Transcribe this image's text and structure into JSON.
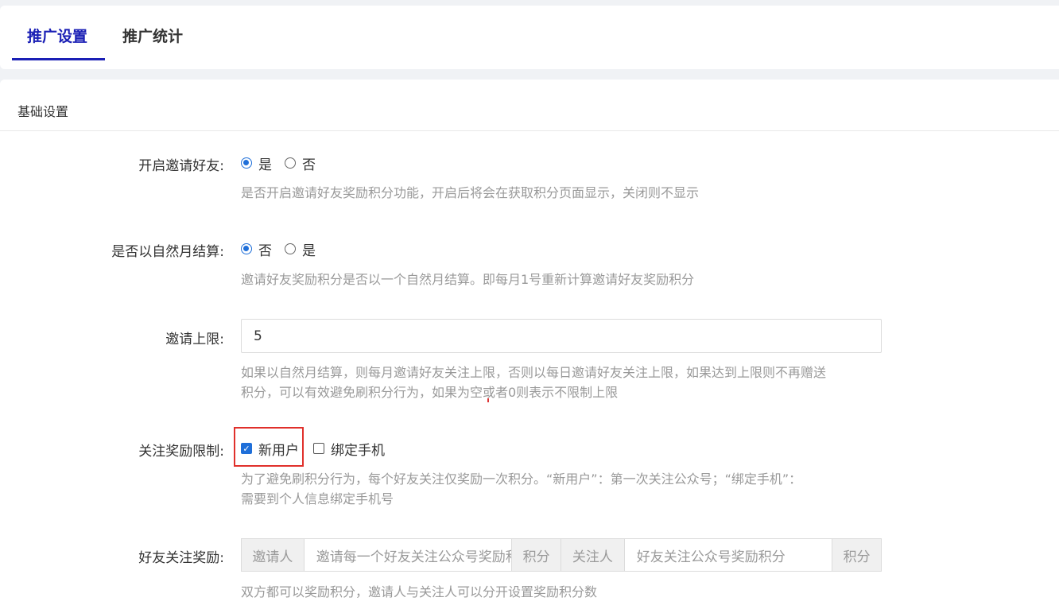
{
  "tabs": [
    {
      "label": "推广设置",
      "active": true
    },
    {
      "label": "推广统计",
      "active": false
    }
  ],
  "section": {
    "title": "基础设置"
  },
  "form": {
    "invite_enable": {
      "label": "开启邀请好友:",
      "options": [
        {
          "label": "是",
          "checked": true
        },
        {
          "label": "否",
          "checked": false
        }
      ],
      "help": "是否开启邀请好友奖励积分功能，开启后将会在获取积分页面显示，关闭则不显示"
    },
    "monthly_settle": {
      "label": "是否以自然月结算:",
      "options": [
        {
          "label": "否",
          "checked": true
        },
        {
          "label": "是",
          "checked": false
        }
      ],
      "help": "邀请好友奖励积分是否以一个自然月结算。即每月1号重新计算邀请好友奖励积分"
    },
    "invite_limit": {
      "label": "邀请上限:",
      "value": "5",
      "help_line1": "如果以自然月结算，则每月邀请好友关注上限，否则以每日邀请好友关注上限，如果达到上限则不再赠送",
      "help_line2": "积分，可以有效避免刷积分行为，如果为空或者0则表示不限制上限"
    },
    "follow_restrict": {
      "label": "关注奖励限制:",
      "options": [
        {
          "label": "新用户",
          "checked": true
        },
        {
          "label": "绑定手机",
          "checked": false
        }
      ],
      "help_line1": "为了避免刷积分行为，每个好友关注仅奖励一次积分。“新用户”：第一次关注公众号；“绑定手机”：",
      "help_line2": "需要到个人信息绑定手机号"
    },
    "follow_reward": {
      "label": "好友关注奖励:",
      "inviter_addon": "邀请人",
      "inviter_placeholder": "邀请每一个好友关注公众号奖励积分",
      "points_addon_1": "积分",
      "follower_addon": "关注人",
      "follower_placeholder": "好友关注公众号奖励积分",
      "points_addon_2": "积分",
      "help": "双方都可以奖励积分，邀请人与关注人可以分开设置奖励积分数"
    }
  },
  "colors": {
    "accent": "#1a1fb5",
    "radio": "#1f6fd9",
    "highlight": "#e0302b"
  }
}
